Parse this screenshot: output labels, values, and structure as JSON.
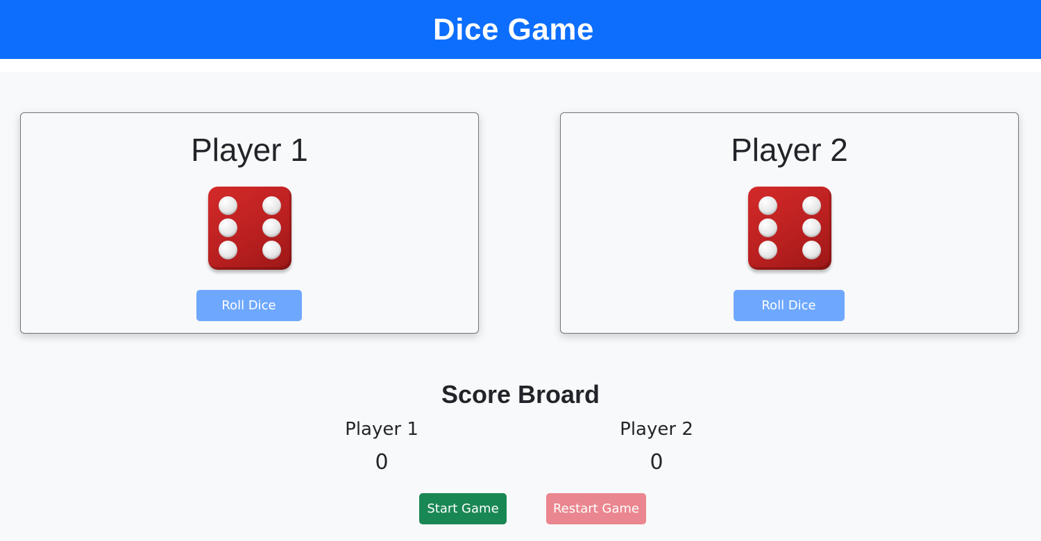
{
  "header": {
    "title": "Dice Game"
  },
  "players": [
    {
      "label": "Player 1",
      "die_value": 6,
      "roll_label": "Roll Dice"
    },
    {
      "label": "Player 2",
      "die_value": 6,
      "roll_label": "Roll Dice"
    }
  ],
  "scoreboard": {
    "title": "Score Broard",
    "entries": [
      {
        "label": "Player 1",
        "score": "0"
      },
      {
        "label": "Player 2",
        "score": "0"
      }
    ]
  },
  "controls": {
    "start_label": "Start Game",
    "restart_label": "Restart Game"
  },
  "colors": {
    "header_bg": "#0d6efd",
    "die_red": "#c62828",
    "roll_button": "#6ea8fe",
    "start_button": "#198754",
    "restart_button": "#ea868f"
  }
}
